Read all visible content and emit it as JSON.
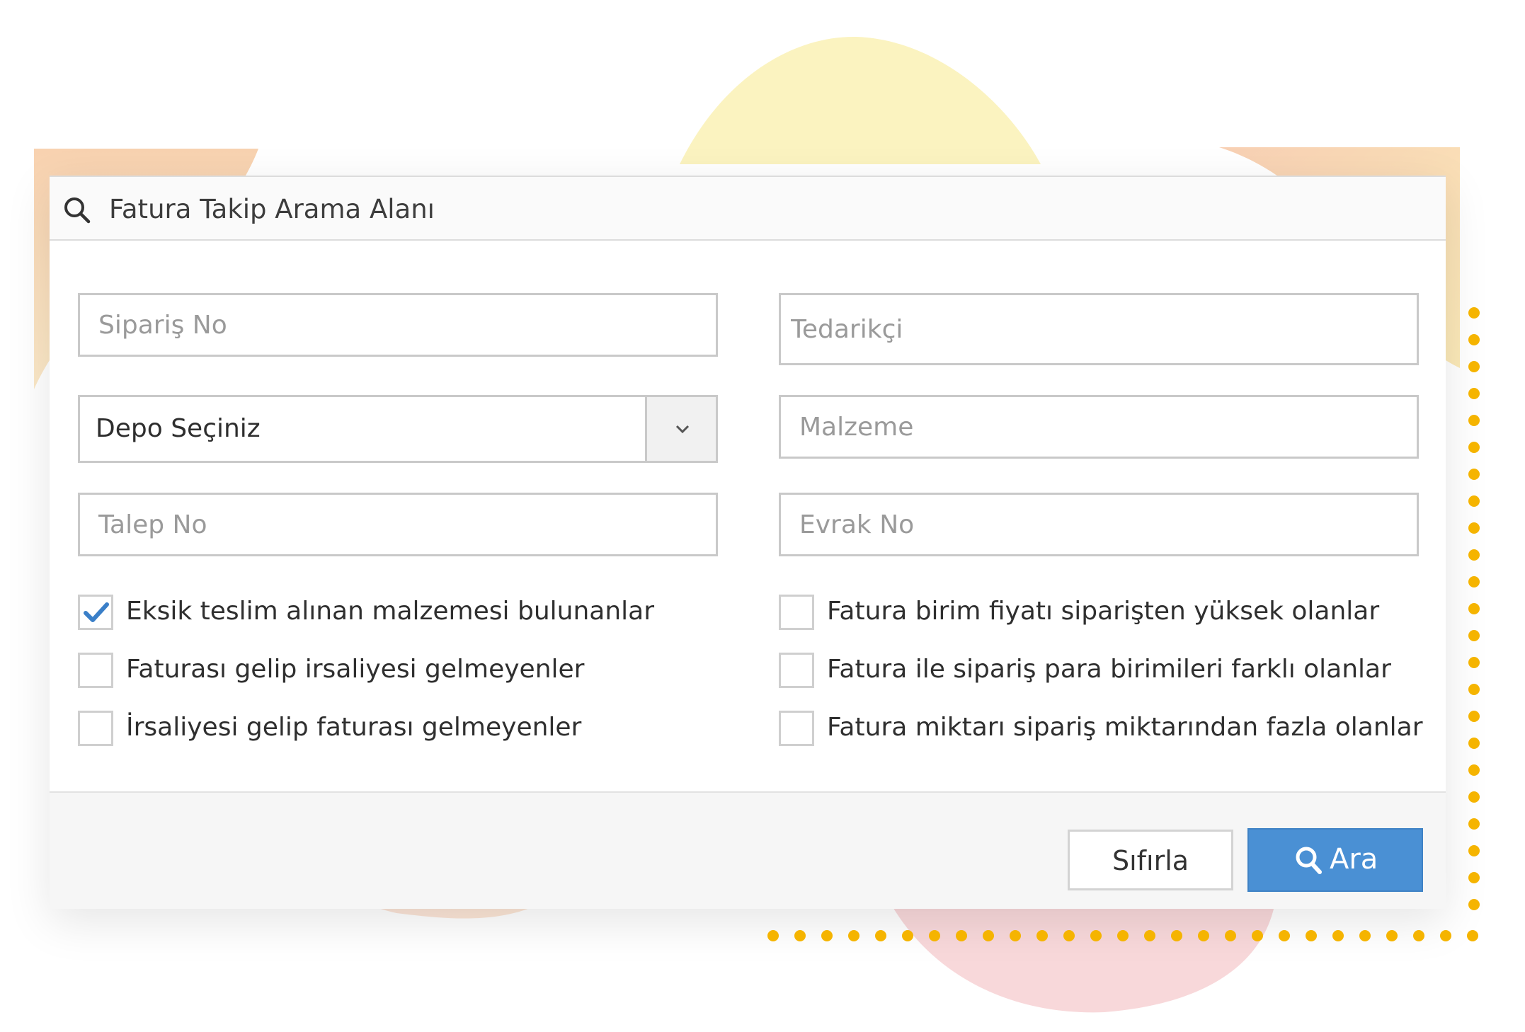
{
  "panel": {
    "title": "Fatura Takip Arama Alanı",
    "title_icon": "search-icon"
  },
  "fields": {
    "siparis_no": {
      "placeholder": "Sipariş No",
      "value": ""
    },
    "tedarikci": {
      "placeholder": "Tedarikçi",
      "value": ""
    },
    "depo": {
      "selected": "Depo Seçiniz",
      "icon": "chevron-down-icon"
    },
    "malzeme": {
      "placeholder": "Malzeme",
      "value": ""
    },
    "talep_no": {
      "placeholder": "Talep No",
      "value": ""
    },
    "evrak_no": {
      "placeholder": "Evrak No",
      "value": ""
    }
  },
  "checkboxes": [
    {
      "label": "Eksik teslim alınan malzemesi bulunanlar",
      "checked": true
    },
    {
      "label": "Faturası gelip irsaliyesi gelmeyenler",
      "checked": false
    },
    {
      "label": "İrsaliyesi gelip faturası gelmeyenler",
      "checked": false
    },
    {
      "label": "Fatura birim fiyatı siparişten yüksek olanlar",
      "checked": false
    },
    {
      "label": "Fatura ile sipariş para birimileri farklı olanlar",
      "checked": false
    },
    {
      "label": "Fatura miktarı sipariş miktarından fazla olanlar",
      "checked": false
    }
  ],
  "buttons": {
    "reset_label": "Sıfırla",
    "search_label": "Ara",
    "search_icon": "search-icon"
  },
  "colors": {
    "accent_blue": "#4a90d4",
    "check_blue": "#3a7fc8",
    "dot_orange": "#f5b400",
    "blob_yellow": "#fbf3c0",
    "blob_peach": "#f8dcc0",
    "blob_pink": "#f8dcdc"
  }
}
